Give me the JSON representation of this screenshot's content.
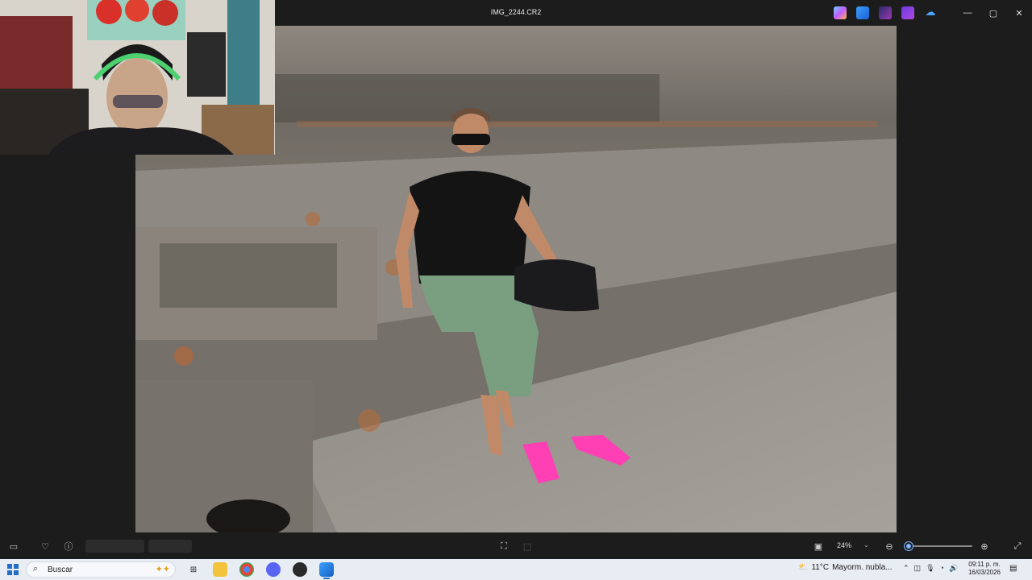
{
  "window": {
    "title": "IMG_2244.CR2",
    "controls": {
      "minimize": "—",
      "maximize": "▢",
      "close": "✕"
    },
    "tray_app_icons": [
      "copilot-icon",
      "photo-editor-icon",
      "clipchamp-icon",
      "media-app-icon",
      "onedrive-icon"
    ]
  },
  "viewer": {
    "image_name": "IMG_2244.CR2"
  },
  "bottom_bar": {
    "zoom_value": "24%",
    "zoom_level": 0.06,
    "zoom_dropdown": "⌄",
    "left_tools": [
      "filmstrip-icon",
      "favorite-heart-icon",
      "info-icon"
    ],
    "center_tools": [
      "crop-fit-icon",
      "select-icon"
    ],
    "right_tools": [
      "fit-window-icon",
      "zoom-out-icon",
      "zoom-in-icon",
      "fullscreen-icon"
    ]
  },
  "taskbar": {
    "search_placeholder": "Buscar",
    "weather_temp": "11°C",
    "weather_desc": "Mayorm. nubla...",
    "time": "09:11 p. m.",
    "date": "16/03/2026",
    "pinned_apps": [
      "task-view-icon",
      "file-explorer-icon",
      "chrome-icon",
      "discord-icon",
      "davinci-icon",
      "photos-icon"
    ]
  },
  "colors": {
    "app_bg": "#1c1c1c",
    "accent": "#7fb6ff",
    "taskbar_bg": "#e8ecf3",
    "sandals": "#ff3fb4"
  }
}
